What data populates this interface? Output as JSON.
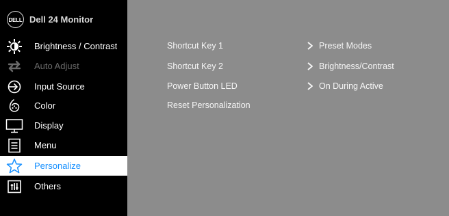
{
  "header": {
    "logo_text": "DELL",
    "title": "Dell 24 Monitor"
  },
  "sidebar": {
    "items": [
      {
        "label": "Brightness / Contrast",
        "icon": "brightness-icon",
        "state": "normal"
      },
      {
        "label": "Auto Adjust",
        "icon": "auto-adjust-icon",
        "state": "disabled"
      },
      {
        "label": "Input Source",
        "icon": "input-source-icon",
        "state": "normal"
      },
      {
        "label": "Color",
        "icon": "color-icon",
        "state": "normal"
      },
      {
        "label": "Display",
        "icon": "display-icon",
        "state": "normal"
      },
      {
        "label": "Menu",
        "icon": "menu-icon",
        "state": "normal"
      },
      {
        "label": "Personalize",
        "icon": "star-icon",
        "state": "selected"
      },
      {
        "label": "Others",
        "icon": "others-icon",
        "state": "normal"
      }
    ]
  },
  "main": {
    "options": [
      {
        "label": "Shortcut Key 1",
        "value": "Preset Modes"
      },
      {
        "label": "Shortcut Key 2",
        "value": "Brightness/Contrast"
      },
      {
        "label": "Power Button LED",
        "value": "On During Active"
      },
      {
        "label": "Reset Personalization",
        "value": ""
      }
    ]
  },
  "colors": {
    "sidebar_bg": "#000000",
    "content_bg": "#8c8c8c",
    "selected_bg": "#ffffff",
    "selected_text": "#1790ff",
    "disabled_text": "#6a6a6a"
  }
}
